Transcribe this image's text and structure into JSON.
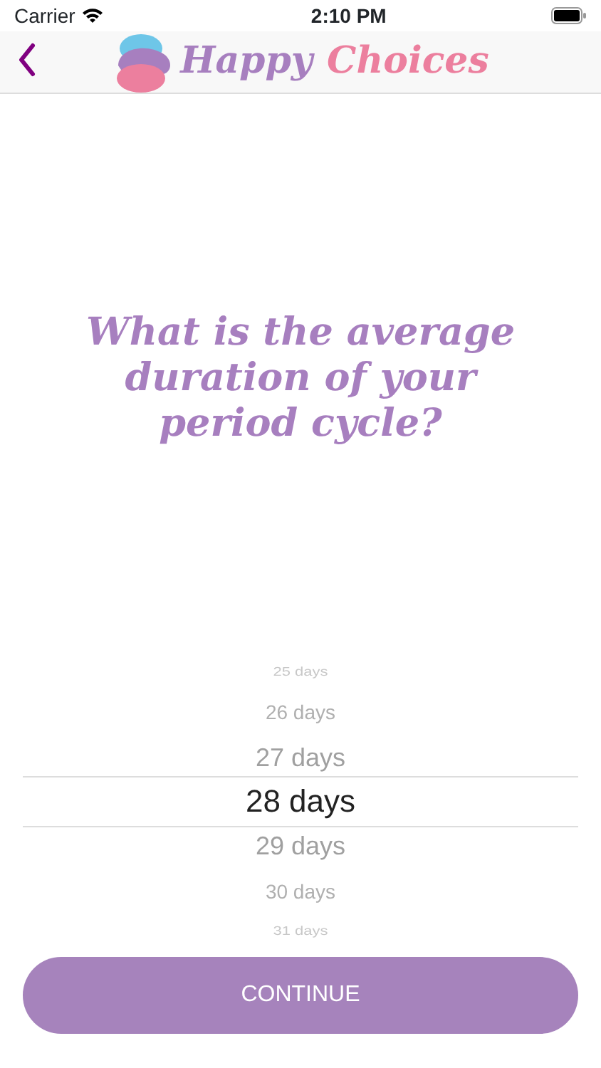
{
  "status_bar": {
    "carrier": "Carrier",
    "time": "2:10 PM"
  },
  "nav": {
    "logo_word_1": "Happy",
    "logo_word_2": "Choices"
  },
  "question": "What is the average duration of your period cycle?",
  "picker": [
    {
      "label": "25 days",
      "selected": false
    },
    {
      "label": "26 days",
      "selected": false
    },
    {
      "label": "27 days",
      "selected": false
    },
    {
      "label": "28 days",
      "selected": true
    },
    {
      "label": "29 days",
      "selected": false
    },
    {
      "label": "30 days",
      "selected": false
    },
    {
      "label": "31 days",
      "selected": false
    }
  ],
  "button": "CONTINUE"
}
